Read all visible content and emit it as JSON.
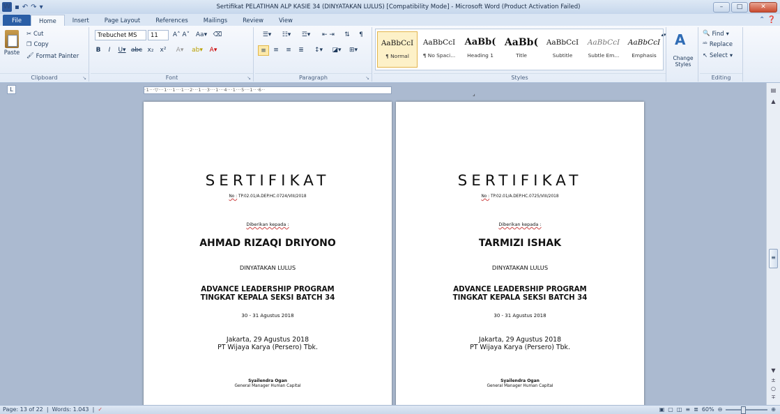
{
  "window": {
    "title": "Sertifikat PELATIHAN ALP KASIE 34 (DINYATAKAN LULUS) [Compatibility Mode]  -  Microsoft Word (Product Activation Failed)",
    "app_icon": "W",
    "minimize": "–",
    "maximize": "□",
    "close": "✕"
  },
  "tabs": [
    "File",
    "Home",
    "Insert",
    "Page Layout",
    "References",
    "Mailings",
    "Review",
    "View"
  ],
  "clipboard": {
    "paste": "Paste",
    "cut": "Cut",
    "copy": "Copy",
    "format_painter": "Format Painter",
    "label": "Clipboard"
  },
  "font": {
    "name": "Trebuchet MS",
    "size": "11",
    "label": "Font"
  },
  "paragraph": {
    "label": "Paragraph"
  },
  "styles": {
    "items": [
      {
        "sample": "AaBbCcI",
        "name": "¶ Normal"
      },
      {
        "sample": "AaBbCcI",
        "name": "¶ No Spaci..."
      },
      {
        "sample": "AaBb(",
        "name": "Heading 1"
      },
      {
        "sample": "AaBb(",
        "name": "Title"
      },
      {
        "sample": "AaBbCcI",
        "name": "Subtitle"
      },
      {
        "sample": "AaBbCcI",
        "name": "Subtle Em..."
      },
      {
        "sample": "AaBbCcI",
        "name": "Emphasis"
      }
    ],
    "change_styles": "Change Styles",
    "label": "Styles"
  },
  "editing": {
    "find": "Find",
    "replace": "Replace",
    "select": "Select",
    "label": "Editing"
  },
  "pages": [
    {
      "title": "SERTIFIKAT",
      "no_label": "No :",
      "no_value": "TP.02.01/A.DEP.HC.0724/VIII/2018",
      "given": "Diberikan kepada :",
      "name": "AHMAD RIZAQI DRIYONO",
      "status": "DINYATAKAN LULUS",
      "program_1": "ADVANCE LEADERSHIP PROGRAM",
      "program_2": "TINGKAT KEPALA SEKSI BATCH 34",
      "date": "30 - 31 Agustus 2018",
      "place": "Jakarta, 29 Agustus 2018",
      "company": "PT Wijaya Karya (Persero) Tbk.",
      "signer": "Syailendra Ogan",
      "position": "General Manager Human Capital"
    },
    {
      "title": "SERTIFIKAT",
      "no_label": "No :",
      "no_value": "TP.02.01/A.DEP.HC.0725/VIII/2018",
      "given": "Diberikan kepada :",
      "name": "TARMIZI ISHAK",
      "status": "DINYATAKAN LULUS",
      "program_1": "ADVANCE LEADERSHIP PROGRAM",
      "program_2": "TINGKAT KEPALA SEKSI BATCH 34",
      "date": "30 - 31 Agustus 2018",
      "place": "Jakarta, 29 Agustus 2018",
      "company": "PT Wijaya Karya (Persero) Tbk.",
      "signer": "Syailendra Ogan",
      "position": "General Manager Human Capital"
    }
  ],
  "status": {
    "page": "Page: 13 of 22",
    "words": "Words: 1.043",
    "zoom": "60%"
  }
}
